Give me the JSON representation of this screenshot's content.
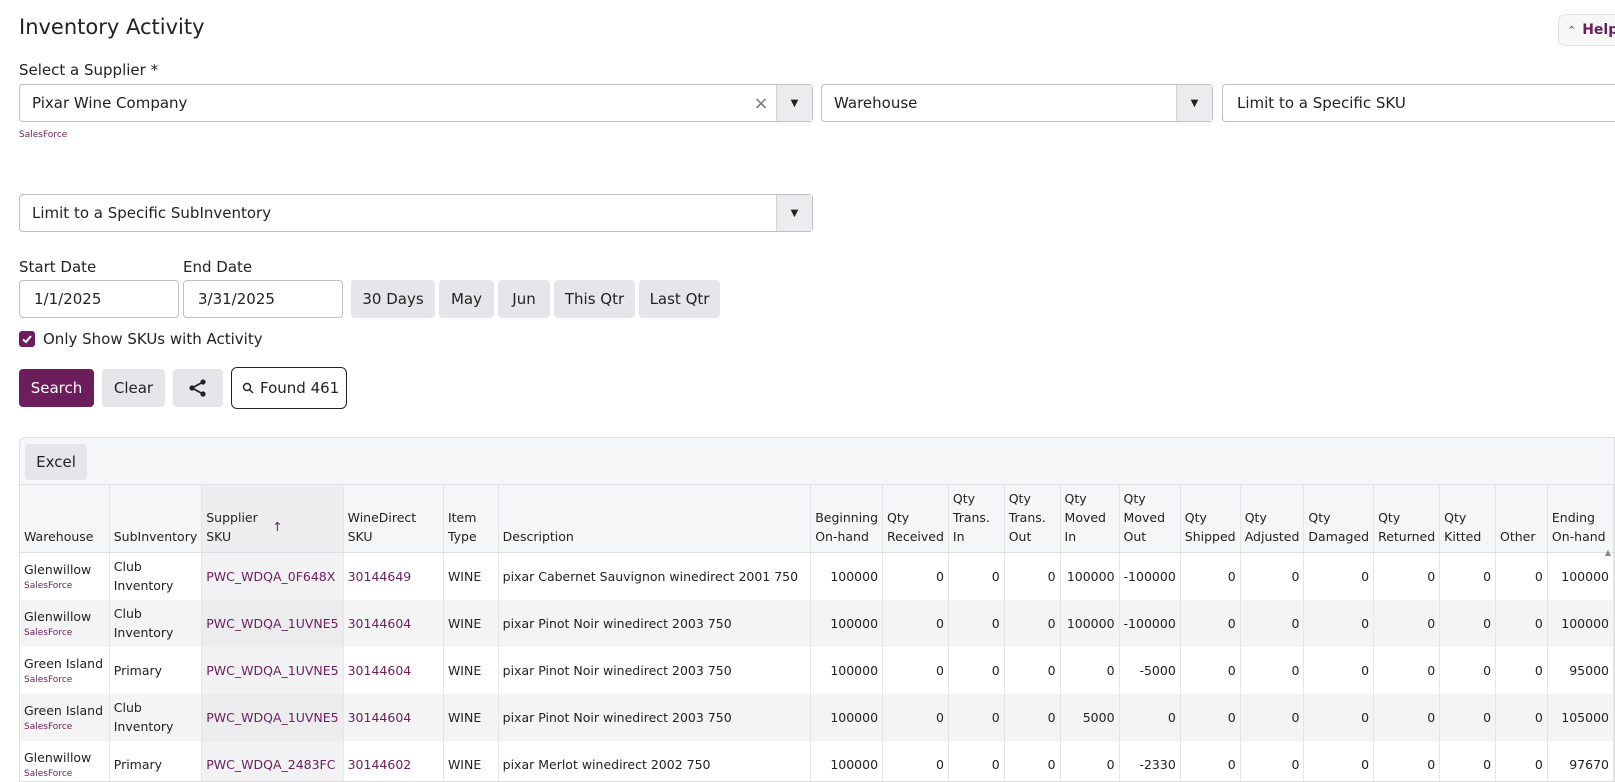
{
  "page": {
    "title": "Inventory Activity",
    "help_label": "Help"
  },
  "filters": {
    "supplier_label": "Select a Supplier *",
    "supplier_value": "Pixar Wine Company",
    "supplier_source": "SalesForce",
    "warehouse_value": "Warehouse",
    "sku_placeholder": "Limit to a Specific SKU",
    "subinventory_value": "Limit to a Specific SubInventory",
    "start_date_label": "Start Date",
    "start_date_value": "1/1/2025",
    "end_date_label": "End Date",
    "end_date_value": "3/31/2025",
    "quick_ranges": [
      "30 Days",
      "May",
      "Jun",
      "This Qtr",
      "Last Qtr"
    ],
    "only_activity_label": "Only Show SKUs with Activity",
    "only_activity_checked": true
  },
  "actions": {
    "search_label": "Search",
    "clear_label": "Clear",
    "found_label": "Found 461"
  },
  "grid": {
    "excel_label": "Excel",
    "columns": [
      "Warehouse",
      "SubInventory",
      "Supplier SKU",
      "WineDirect SKU",
      "Item Type",
      "Description",
      "Beginning On-hand",
      "Qty Received",
      "Qty Trans. In",
      "Qty Trans. Out",
      "Qty Moved In",
      "Qty Moved Out",
      "Qty Shipped",
      "Qty Adjusted",
      "Qty Damaged",
      "Qty Returned",
      "Qty Kitted",
      "Other",
      "Ending On-hand"
    ],
    "sort_indicator": "↑",
    "rows": [
      {
        "warehouse": "Glenwillow",
        "source": "SalesForce",
        "subinventory": "Club Inventory",
        "supplier_sku": "PWC_WDQA_0F648X",
        "winedirect_sku": "30144649",
        "item_type": "WINE",
        "description": "pixar Cabernet Sauvignon winedirect 2001 750",
        "beginning": "100000",
        "received": "0",
        "trans_in": "0",
        "trans_out": "0",
        "moved_in": "100000",
        "moved_out": "-100000",
        "shipped": "0",
        "adjusted": "0",
        "damaged": "0",
        "returned": "0",
        "kitted": "0",
        "other": "0",
        "ending": "100000"
      },
      {
        "warehouse": "Glenwillow",
        "source": "SalesForce",
        "subinventory": "Club Inventory",
        "supplier_sku": "PWC_WDQA_1UVNE5",
        "winedirect_sku": "30144604",
        "item_type": "WINE",
        "description": "pixar Pinot Noir winedirect 2003 750",
        "beginning": "100000",
        "received": "0",
        "trans_in": "0",
        "trans_out": "0",
        "moved_in": "100000",
        "moved_out": "-100000",
        "shipped": "0",
        "adjusted": "0",
        "damaged": "0",
        "returned": "0",
        "kitted": "0",
        "other": "0",
        "ending": "100000"
      },
      {
        "warehouse": "Green Island",
        "source": "SalesForce",
        "subinventory": "Primary",
        "supplier_sku": "PWC_WDQA_1UVNE5",
        "winedirect_sku": "30144604",
        "item_type": "WINE",
        "description": "pixar Pinot Noir winedirect 2003 750",
        "beginning": "100000",
        "received": "0",
        "trans_in": "0",
        "trans_out": "0",
        "moved_in": "0",
        "moved_out": "-5000",
        "shipped": "0",
        "adjusted": "0",
        "damaged": "0",
        "returned": "0",
        "kitted": "0",
        "other": "0",
        "ending": "95000"
      },
      {
        "warehouse": "Green Island",
        "source": "SalesForce",
        "subinventory": "Club Inventory",
        "supplier_sku": "PWC_WDQA_1UVNE5",
        "winedirect_sku": "30144604",
        "item_type": "WINE",
        "description": "pixar Pinot Noir winedirect 2003 750",
        "beginning": "100000",
        "received": "0",
        "trans_in": "0",
        "trans_out": "0",
        "moved_in": "5000",
        "moved_out": "0",
        "shipped": "0",
        "adjusted": "0",
        "damaged": "0",
        "returned": "0",
        "kitted": "0",
        "other": "0",
        "ending": "105000"
      },
      {
        "warehouse": "Glenwillow",
        "source": "SalesForce",
        "subinventory": "Primary",
        "supplier_sku": "PWC_WDQA_2483FC",
        "winedirect_sku": "30144602",
        "item_type": "WINE",
        "description": "pixar Merlot winedirect 2002 750",
        "beginning": "100000",
        "received": "0",
        "trans_in": "0",
        "trans_out": "0",
        "moved_in": "0",
        "moved_out": "-2330",
        "shipped": "0",
        "adjusted": "0",
        "damaged": "0",
        "returned": "0",
        "kitted": "0",
        "other": "0",
        "ending": "97670"
      }
    ]
  },
  "colors": {
    "brand": "#6b1d5c",
    "button_gray": "#e6e6ea",
    "header_bg": "#f5f6f8"
  },
  "icons": {
    "help": "chevron-up-down-icon",
    "clear": "close-icon",
    "dropdown": "caret-down-icon",
    "checkbox": "check-icon",
    "share": "share-icon",
    "found": "search-icon"
  }
}
